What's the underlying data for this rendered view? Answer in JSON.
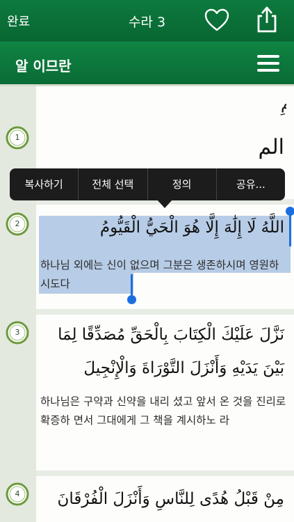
{
  "topbar": {
    "done_label": "완료",
    "title": "수라 3"
  },
  "subbar": {
    "surah_name": "알 이므란"
  },
  "bismillah": {
    "text": "بِسْمِ اللَّهِ الرَّحْمَنِ الرَّحِيمِ"
  },
  "context_menu": {
    "items": [
      "복사하기",
      "전체 선택",
      "정의",
      "공유..."
    ]
  },
  "verses": [
    {
      "number": "1",
      "arabic": "الم",
      "translation": ""
    },
    {
      "number": "2",
      "arabic": "اللَّهُ لَا إِلَٰهَ إِلَّا هُوَ الْحَيُّ الْقَيُّومُ",
      "translation": "하나님 외에는 신이 없으며 그분은 생존하시며 영원하시도다"
    },
    {
      "number": "3",
      "arabic_line1": "نَزَّلَ عَلَيْكَ الْكِتَابَ بِالْحَقِّ مُصَدِّقًا لِمَا",
      "arabic_line2": "بَيْنَ يَدَيْهِ وَأَنْزَلَ التَّوْرَاةَ وَالْإِنْجِيلَ",
      "translation": "하나님은 구약과 신약을 내리 셨고 앞서 온 것을 진리로 확증하 면서 그대에게 그 책을 계시하노 라"
    },
    {
      "number": "4",
      "arabic": "مِنْ قَبْلُ هُدًى لِلنَّاسِ وَأَنْزَلَ الْفُرْقَانَ"
    }
  ],
  "colors": {
    "accent_green": "#0a6b35",
    "selection": "#7ea4d5",
    "handle_blue": "#1a6fe0"
  },
  "icons": {
    "favorite": "heart-icon",
    "share": "share-icon",
    "menu": "hamburger-menu-icon"
  }
}
